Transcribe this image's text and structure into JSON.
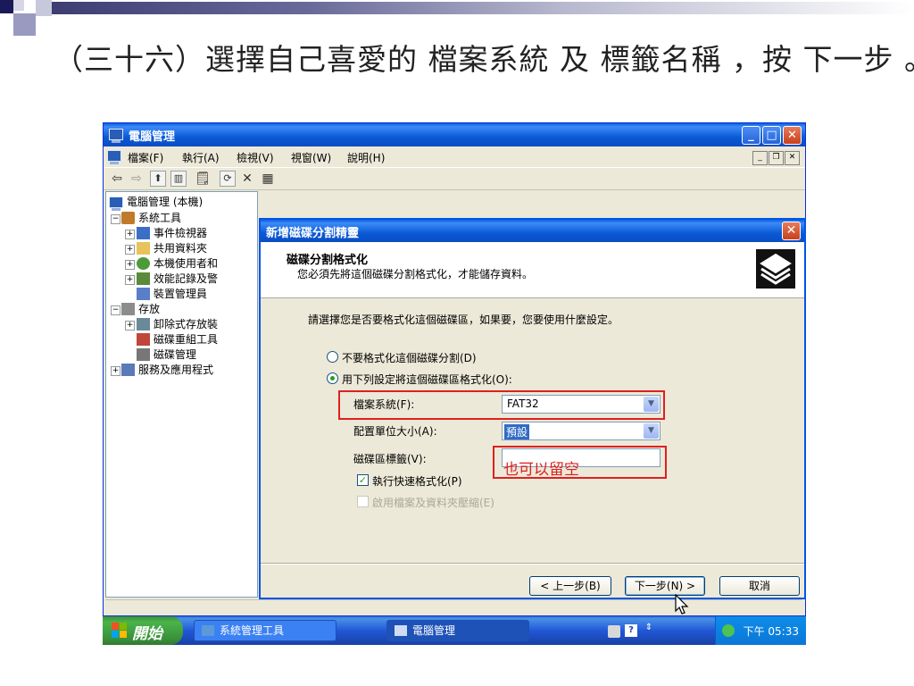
{
  "slide": {
    "title": "（三十六）選擇自己喜愛的 檔案系統 及 標籤名稱 ，按 下一步 。"
  },
  "window": {
    "title": "電腦管理",
    "menu": [
      {
        "label": "檔案(F)"
      },
      {
        "label": "執行(A)"
      },
      {
        "label": "檢視(V)"
      },
      {
        "label": "視窗(W)"
      },
      {
        "label": "說明(H)"
      }
    ]
  },
  "tree": {
    "root": "電腦管理 (本機)",
    "system_tools": "系統工具",
    "event_viewer": "事件檢視器",
    "shared_folders": "共用資料夾",
    "local_users": "本機使用者和",
    "perf_logs": "效能記錄及警",
    "device_manager": "裝置管理員",
    "storage": "存放",
    "removable_storage": "卸除式存放裝",
    "defrag": "磁碟重組工具",
    "disk_management": "磁碟管理",
    "services_apps": "服務及應用程式"
  },
  "wizard": {
    "title": "新增磁碟分割精靈",
    "header_title": "磁碟分割格式化",
    "header_sub": "您必須先將這個磁碟分割格式化，才能儲存資料。",
    "prompt": "請選擇您是否要格式化這個磁碟區，如果要，您要使用什麼設定。",
    "option_no_format": "不要格式化這個磁碟分割(D)",
    "option_format": "用下列設定將這個磁碟區格式化(O):",
    "fs_label": "檔案系統(F):",
    "fs_value": "FAT32",
    "alloc_label": "配置單位大小(A):",
    "alloc_value": "預設",
    "volume_label": "磁碟區標籤(V):",
    "volume_value": "",
    "quick_format": "執行快速格式化(P)",
    "compression": "啟用檔案及資料夾壓縮(E)",
    "note": "也可以留空",
    "back_button": "< 上一步(B)",
    "next_button": "下一步(N) >",
    "cancel_button": "取消"
  },
  "taskbar": {
    "start": "開始",
    "task1": "系統管理工具",
    "task2": "電腦管理",
    "clock": "下午 05:33"
  }
}
